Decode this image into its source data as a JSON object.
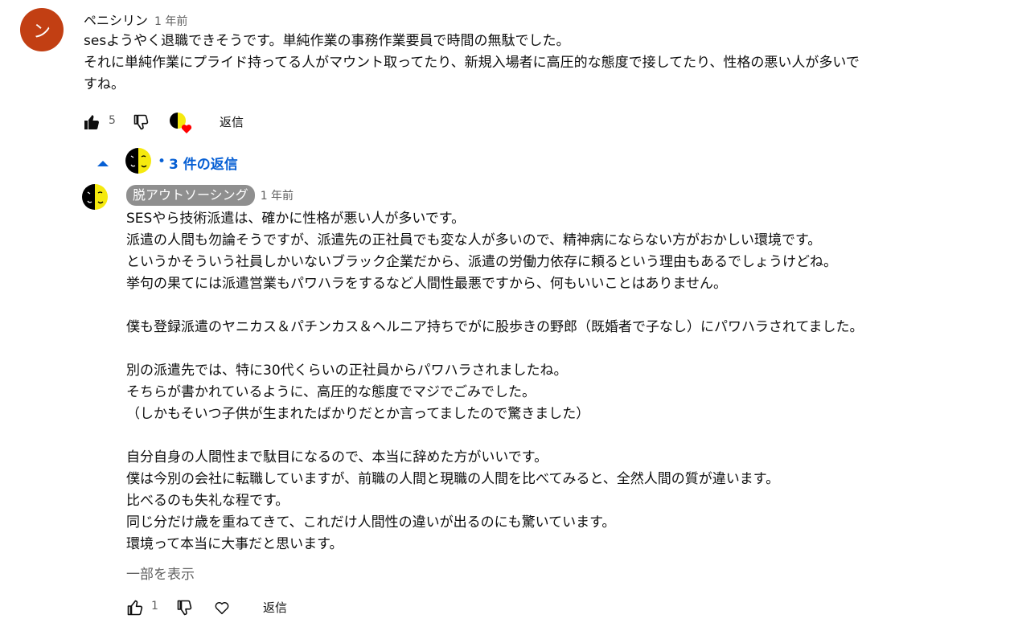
{
  "comment1": {
    "avatar_letter": "ン",
    "author": "ペニシリン",
    "timestamp": "1 年前",
    "text": "sesようやく退職できそうです。単純作業の事務作業要員で時間の無駄でした。\nそれに単純作業にプライド持ってる人がマウント取ってたり、新規入場者に高圧的な態度で接してたり、性格の悪い人が多いで\nすね。",
    "like_count": "5",
    "reply_label": "返信"
  },
  "replies_toggle": {
    "label": "3 件の返信"
  },
  "reply1": {
    "author": "脱アウトソーシング",
    "timestamp": "1 年前",
    "text": "SESやら技術派遣は、確かに性格が悪い人が多いです。\n派遣の人間も勿論そうですが、派遣先の正社員でも変な人が多いので、精神病にならない方がおかしい環境です。\nというかそういう社員しかいないブラック企業だから、派遣の労働力依存に頼るという理由もあるでしょうけどね。\n挙句の果てには派遣営業もパワハラをするなど人間性最悪ですから、何もいいことはありません。\n\n僕も登録派遣のヤニカス＆パチンカス＆ヘルニア持ちでがに股歩きの野郎（既婚者で子なし）にパワハラされてました。\n\n別の派遣先では、特に30代くらいの正社員からパワハラされましたね。\nそちらが書かれているように、高圧的な態度でマジでごみでした。\n（しかもそいつ子供が生まれたばかりだとか言ってましたので驚きました）\n\n自分自身の人間性まで駄目になるので、本当に辞めた方がいいです。\n僕は今別の会社に転職していますが、前職の人間と現職の人間を比べてみると、全然人間の質が違います。\n比べるのも失礼な程です。\n同じ分だけ歳を重ねてきて、これだけ人間性の違いが出るのにも驚いています。\n環境って本当に大事だと思います。",
    "show_more": "一部を表示",
    "like_count": "1",
    "reply_label": "返信"
  },
  "colors": {
    "avatar_bg": "#c23f13",
    "link": "#065fd4",
    "chip_bg": "#8f8f8f",
    "heart": "#ff0000"
  }
}
